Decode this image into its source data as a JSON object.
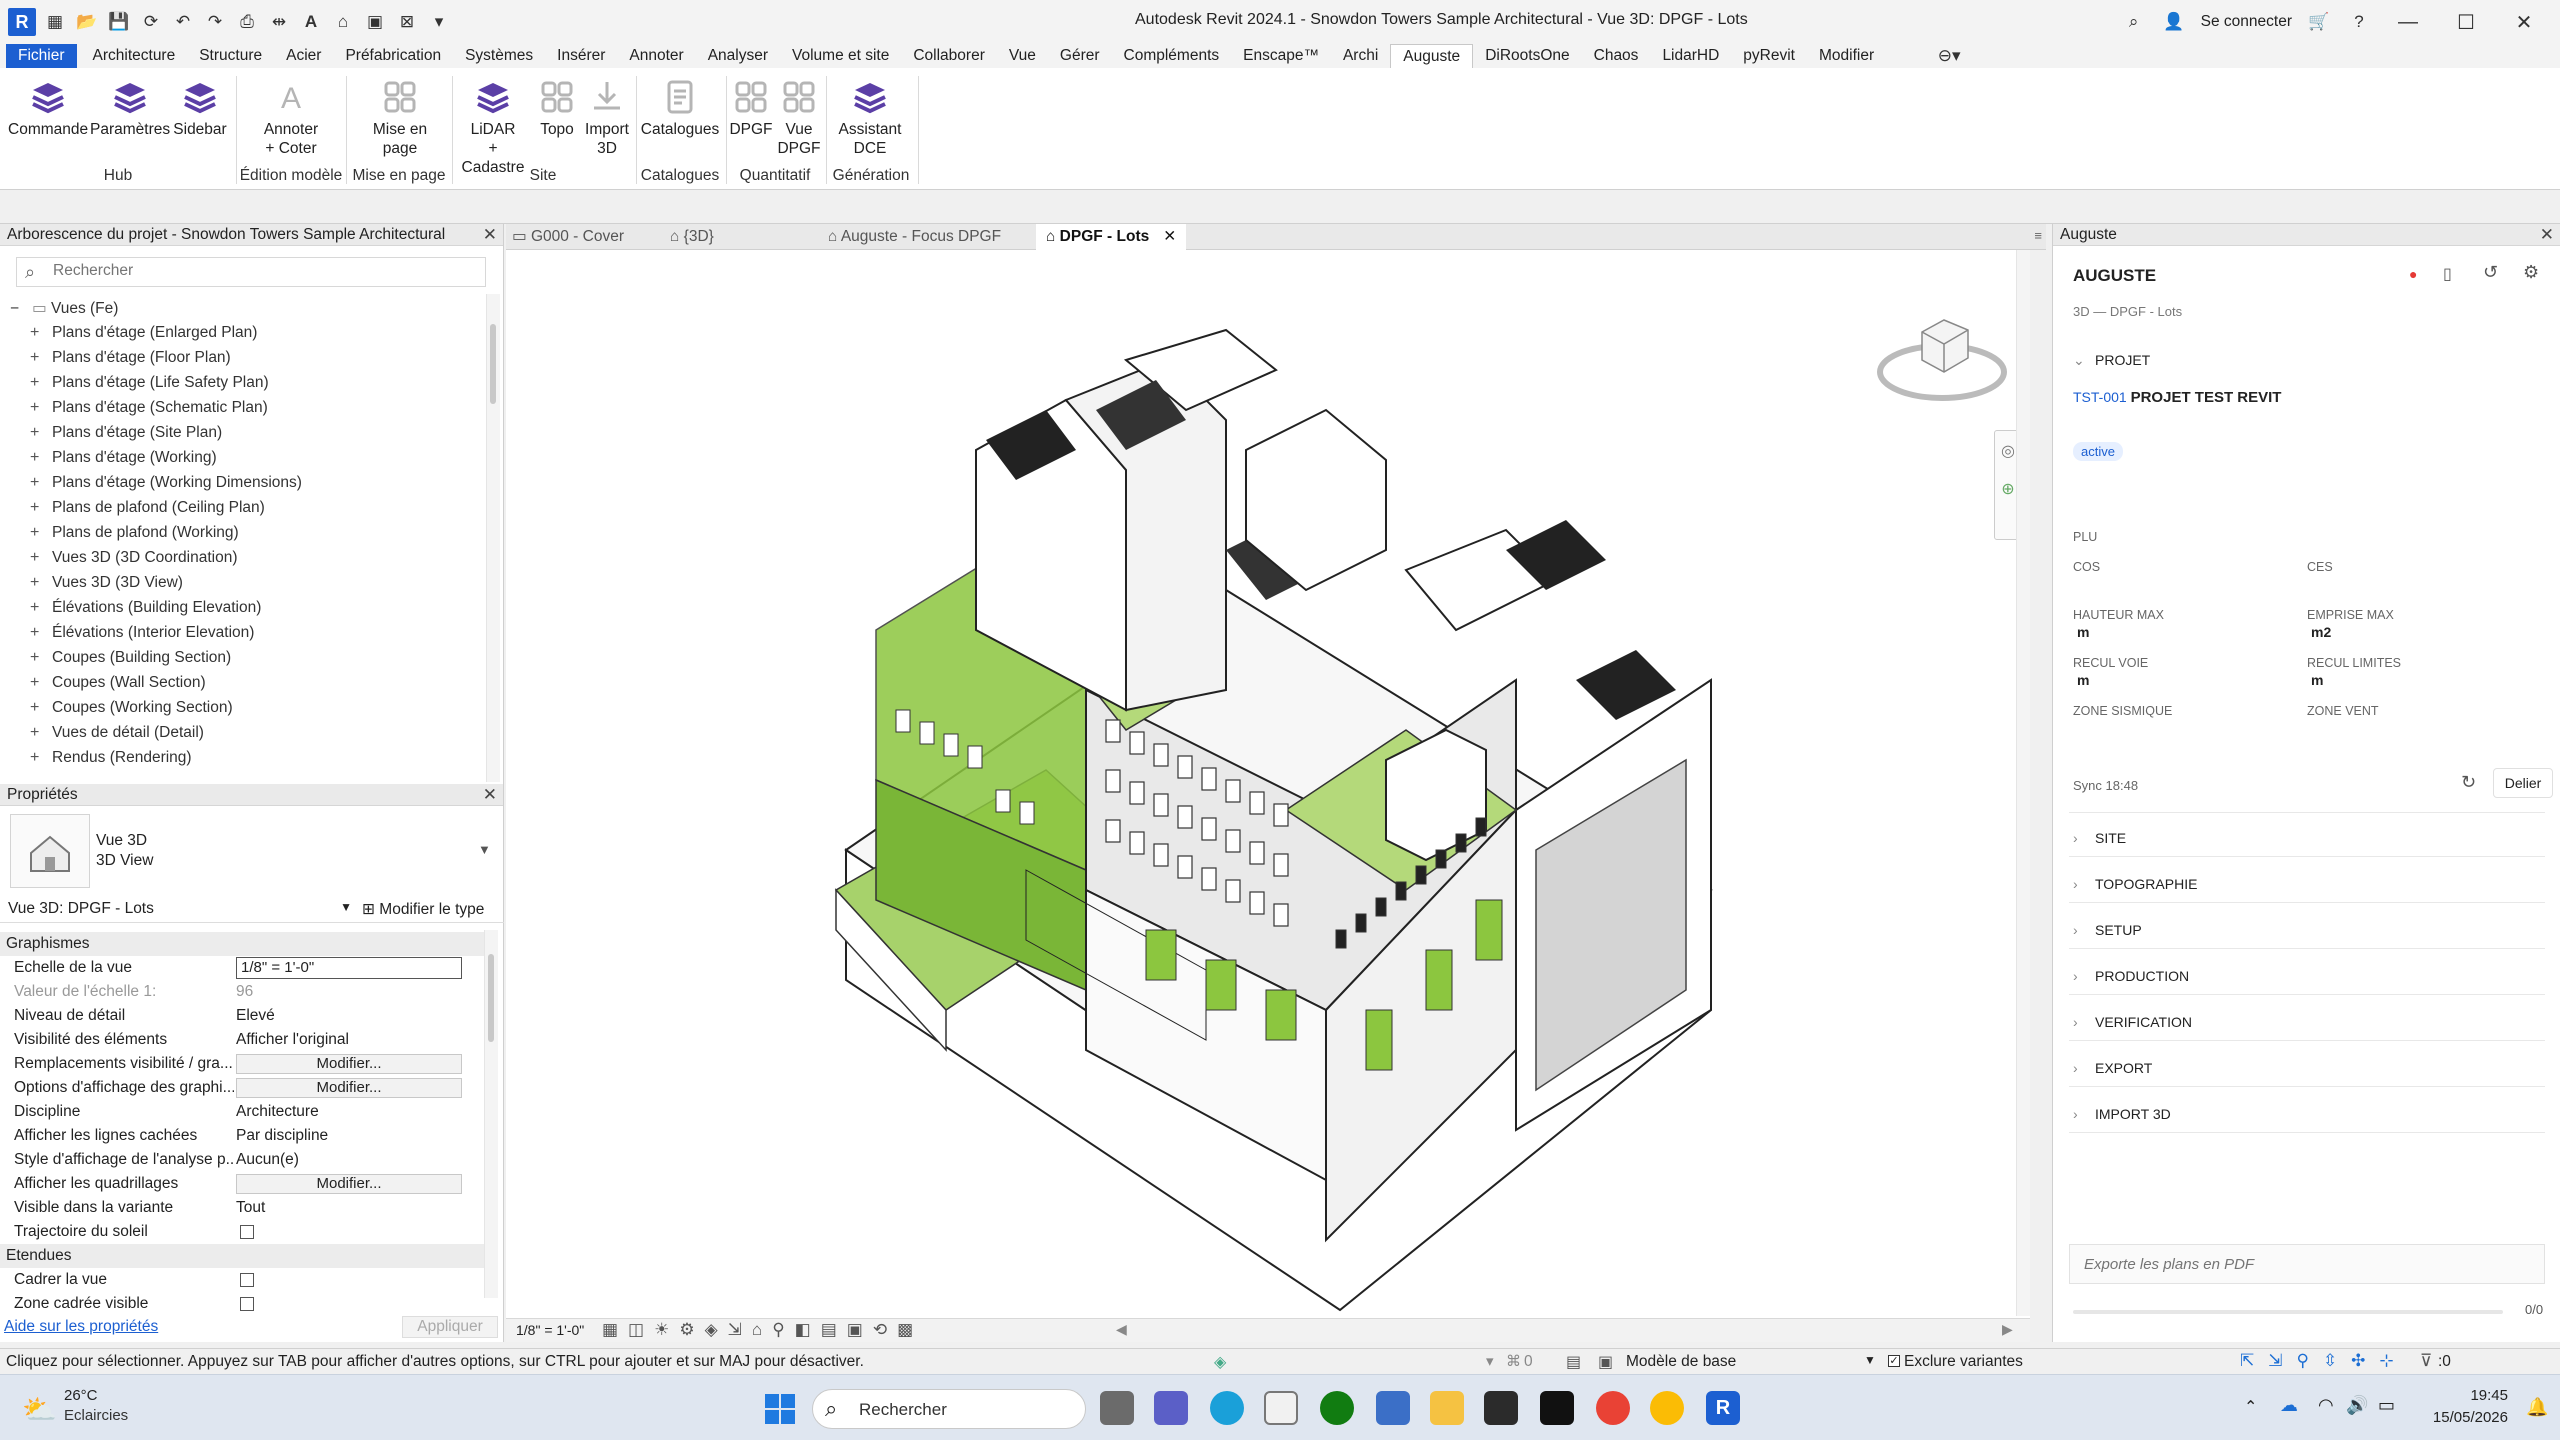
{
  "titlebar": {
    "title": "Autodesk Revit 2024.1 - Snowdon Towers Sample Architectural - Vue 3D: DPGF - Lots",
    "sign_in": "Se connecter"
  },
  "menu": [
    "Fichier",
    "Architecture",
    "Structure",
    "Acier",
    "Préfabrication",
    "Systèmes",
    "Insérer",
    "Annoter",
    "Analyser",
    "Volume et site",
    "Collaborer",
    "Vue",
    "Gérer",
    "Compléments",
    "Enscape™",
    "Archi",
    "Auguste",
    "DiRootsOne",
    "Chaos",
    "LidarHD",
    "pyRevit",
    "Modifier"
  ],
  "ribbon": {
    "buttons": [
      {
        "label": "Commande",
        "label2": ""
      },
      {
        "label": "Paramètres",
        "label2": ""
      },
      {
        "label": "Sidebar",
        "label2": ""
      },
      {
        "label": "Annoter",
        "label2": "+ Coter"
      },
      {
        "label": "Mise en",
        "label2": "page"
      },
      {
        "label": "LiDAR",
        "label2": "+ Cadastre"
      },
      {
        "label": "Topo",
        "label2": ""
      },
      {
        "label": "Import",
        "label2": "3D"
      },
      {
        "label": "Catalogues",
        "label2": ""
      },
      {
        "label": "DPGF",
        "label2": ""
      },
      {
        "label": "Vue",
        "label2": "DPGF"
      },
      {
        "label": "Assistant",
        "label2": "DCE"
      }
    ],
    "panels": [
      "Hub",
      "Édition modèle",
      "Mise en page",
      "Site",
      "Catalogues",
      "Quantitatif",
      "Génération"
    ]
  },
  "browser": {
    "title": "Arborescence du projet - Snowdon Towers Sample Architectural",
    "search_placeholder": "Rechercher",
    "root": "Vues (Fe)",
    "items": [
      "Plans d'étage (Enlarged Plan)",
      "Plans d'étage (Floor Plan)",
      "Plans d'étage (Life Safety Plan)",
      "Plans d'étage (Schematic Plan)",
      "Plans d'étage (Site Plan)",
      "Plans d'étage (Working)",
      "Plans d'étage (Working Dimensions)",
      "Plans de plafond (Ceiling Plan)",
      "Plans de plafond (Working)",
      "Vues 3D (3D Coordination)",
      "Vues 3D (3D View)",
      "Élévations (Building Elevation)",
      "Élévations (Interior Elevation)",
      "Coupes (Building Section)",
      "Coupes (Wall Section)",
      "Coupes (Working Section)",
      "Vues de détail (Detail)",
      "Rendus (Rendering)"
    ]
  },
  "properties": {
    "title": "Propriétés",
    "type_line1": "Vue 3D",
    "type_line2": "3D View",
    "selector": "Vue 3D: DPGF - Lots",
    "edit_type": "Modifier le type",
    "group_graphics": "Graphismes",
    "group_extents": "Etendues",
    "rows": [
      {
        "k": "Echelle de la vue",
        "v": "1/8\" = 1'-0\""
      },
      {
        "k": "Valeur de l'échelle    1:",
        "v": "96"
      },
      {
        "k": "Niveau de détail",
        "v": "Elevé"
      },
      {
        "k": "Visibilité des éléments",
        "v": "Afficher l'original"
      },
      {
        "k": "Remplacements visibilité / gra...",
        "v": "Modifier..."
      },
      {
        "k": "Options d'affichage des graphi...",
        "v": "Modifier..."
      },
      {
        "k": "Discipline",
        "v": "Architecture"
      },
      {
        "k": "Afficher les lignes cachées",
        "v": "Par discipline"
      },
      {
        "k": "Style d'affichage de l'analyse p...",
        "v": "Aucun(e)"
      },
      {
        "k": "Afficher les quadrillages",
        "v": "Modifier..."
      },
      {
        "k": "Visible dans la variante",
        "v": "Tout"
      },
      {
        "k": "Trajectoire du soleil",
        "v": ""
      }
    ],
    "extent_rows": [
      {
        "k": "Cadrer la vue"
      },
      {
        "k": "Zone cadrée visible"
      }
    ],
    "help_link": "Aide sur les propriétés",
    "apply": "Appliquer"
  },
  "tabs": [
    "G000 - Cover",
    "{3D}",
    "Auguste - Focus DPGF",
    "DPGF - Lots"
  ],
  "viewcontrol": {
    "scale": "1/8\" = 1'-0\""
  },
  "auguste": {
    "header": "Auguste",
    "title": "AUGUSTE",
    "subtitle": "3D — DPGF - Lots",
    "section_project": "PROJET",
    "project_code": "TST-001",
    "project_name": "PROJET TEST REVIT",
    "status": "active",
    "plu": "PLU",
    "cos": "COS",
    "ces": "CES",
    "hauteur_max": "HAUTEUR MAX",
    "hauteur_unit": "m",
    "emprise_max": "EMPRISE MAX",
    "emprise_unit": "m2",
    "recul_voie": "RECUL VOIE",
    "recul_voie_unit": "m",
    "recul_limites": "RECUL LIMITES",
    "recul_limites_unit": "m",
    "zone_sismique": "ZONE SISMIQUE",
    "zone_vent": "ZONE VENT",
    "sync": "Sync 18:48",
    "unlink": "Delier",
    "sections": [
      "SITE",
      "TOPOGRAPHIE",
      "SETUP",
      "PRODUCTION",
      "VERIFICATION",
      "EXPORT",
      "IMPORT 3D"
    ],
    "pdf_placeholder": "Exporte les plans en PDF",
    "progress": "0/0"
  },
  "statusbar": {
    "hint": "Cliquez pour sélectionner. Appuyez sur TAB pour afficher d'autres options, sur CTRL pour ajouter et sur MAJ pour désactiver.",
    "model": "Modèle de base",
    "exclude": "Exclure variantes",
    "zero": "0",
    "filter": ":0"
  },
  "taskbar": {
    "temp": "26°C",
    "weather": "Eclaircies",
    "search": "Rechercher",
    "time": "19:45",
    "date": "15/05/2026"
  },
  "colors": {
    "accent": "#1c5fd1",
    "auguste_purple": "#5b3fa6",
    "model_green": "#8cc63f"
  }
}
